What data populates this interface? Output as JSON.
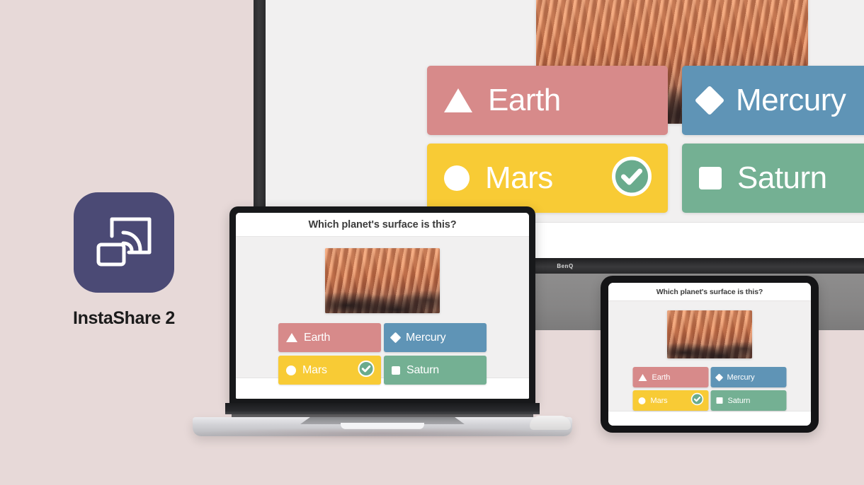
{
  "brand": {
    "app_name": "InstaShare 2",
    "icon_name": "screen-cast-icon",
    "icon_bg": "#4b4a75"
  },
  "monitor": {
    "vendor_logo": "BenQ"
  },
  "quiz": {
    "question": "Which planet's surface is this?",
    "hero_image_alt": "mars-surface-photo",
    "answers": [
      {
        "shape": "triangle",
        "label": "Earth",
        "color": "#d78a8a",
        "selected": false
      },
      {
        "shape": "diamond",
        "label": "Mercury",
        "color": "#5f94b6",
        "selected": false
      },
      {
        "shape": "circle",
        "label": "Mars",
        "color": "#f8cb35",
        "selected": true
      },
      {
        "shape": "square",
        "label": "Saturn",
        "color": "#74b093",
        "selected": false
      }
    ],
    "correct_badge": {
      "name": "check-circle-icon",
      "circle_color": "#6aab8d",
      "ring_color": "#ffffff"
    }
  },
  "theme": {
    "background": "#e7d9d8",
    "screen_bg": "#f1f0f0",
    "title_color": "#3c3c3c"
  }
}
